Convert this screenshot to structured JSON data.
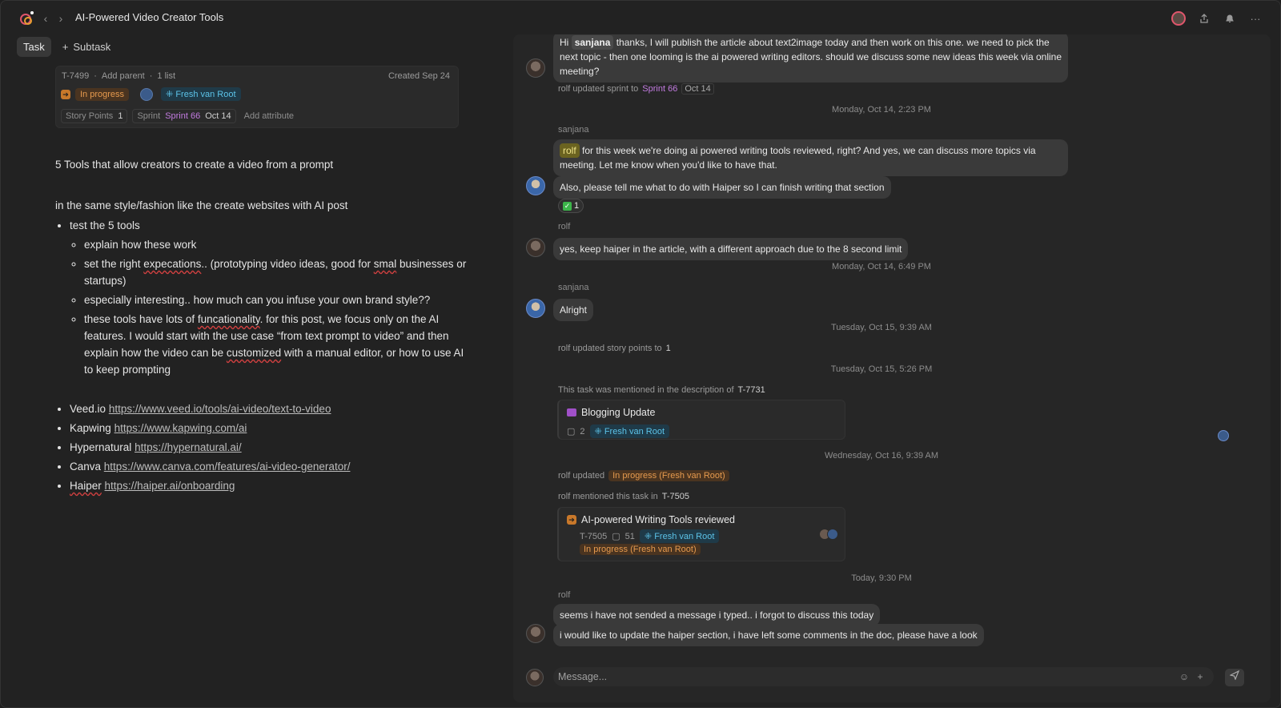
{
  "window": {
    "title": "AI-Powered Video Creator Tools"
  },
  "tabs": {
    "task": "Task",
    "subtask": "Subtask"
  },
  "meta": {
    "id": "T-7499",
    "add_parent": "Add parent",
    "lists": "1 list",
    "created": "Created Sep 24",
    "status": "In progress",
    "team": "Fresh van Root",
    "story_points_label": "Story Points",
    "story_points": "1",
    "sprint_label": "Sprint",
    "sprint": "Sprint 66",
    "sprint_date": "Oct 14",
    "add_attribute": "Add attribute"
  },
  "doc": {
    "heading": "5 Tools that allow creators to create a video from a prompt",
    "intro": "in the same style/fashion like the create websites with AI post",
    "bullet1": "test the 5 tools",
    "sub1": "explain how these work",
    "sub2a": "set the right ",
    "sub2b": "expecations",
    "sub2c": ".. (prototyping video ideas, good for ",
    "sub2d": "smal",
    "sub2e": " businesses or startups)",
    "sub3": "especially interesting.. how much can you infuse your own brand style??",
    "sub4a": "these tools have lots of ",
    "sub4b": "funcationality",
    "sub4c": ". for this post, we focus only on the AI features. I would start with the use case “from text prompt to video” and then explain how the video can be ",
    "sub4d": "customized",
    "sub4e": " with a manual editor, or how to use AI to keep prompting",
    "links": [
      {
        "name": "Veed.io",
        "url": "https://www.veed.io/tools/ai-video/text-to-video"
      },
      {
        "name": "Kapwing",
        "url": "https://www.kapwing.com/ai"
      },
      {
        "name": "Hypernatural",
        "url": "https://hypernatural.ai/"
      },
      {
        "name": "Canva",
        "url": "https://www.canva.com/features/ai-video-generator/"
      },
      {
        "name": "Haiper",
        "url": "https://haiper.ai/onboarding"
      }
    ]
  },
  "chat": {
    "m1_pre": "Hi",
    "m1_mention": "sanjana",
    "m1_post": " thanks, I will publish the article about text2image today and then work on this one. we need to pick the next topic - then one looming is the ai powered writing editors. should we discuss some new ideas this week via online meeting?",
    "sys1_pre": "rolf updated sprint to",
    "sys1_sprint": "Sprint 66",
    "sys1_date": "Oct 14",
    "date1": "Monday, Oct 14, 2:23 PM",
    "sender_sanjana": "sanjana",
    "sender_rolf": "rolf",
    "m2_mention": "rolf",
    "m2_text": " for this week we're doing ai powered writing tools reviewed, right? And yes, we can discuss more topics via meeting. Let me know when you'd like to have that.",
    "m3": "Also, please tell me what to do with Haiper so I can finish writing that section",
    "reaction_count": "1",
    "m4": "yes, keep haiper in the article, with a different approach due to the 8 second limit",
    "date2": "Monday, Oct 14, 6:49 PM",
    "m5": "Alright",
    "date3": "Tuesday, Oct 15, 9:39 AM",
    "sys2_pre": "rolf updated story points to",
    "sys2_val": "1",
    "date4": "Tuesday, Oct 15, 5:26 PM",
    "sys3_pre": "This task was mentioned in the description of",
    "sys3_id": "T-7731",
    "card1_title": "Blogging Update",
    "card1_comments": "2",
    "card1_team": "Fresh van Root",
    "date5": "Wednesday, Oct 16, 9:39 AM",
    "sys4_pre": "rolf updated",
    "sys4_status": "In progress (Fresh van Root)",
    "sys5_pre": "rolf mentioned this task in",
    "sys5_id": "T-7505",
    "card2_title": "AI-powered Writing Tools reviewed",
    "card2_id": "T-7505",
    "card2_comments": "51",
    "card2_team": "Fresh van Root",
    "card2_status": "In progress (Fresh van Root)",
    "date6": "Today, 9:30 PM",
    "m6": "seems i have not sended a message i typed.. i forgot to discuss this today",
    "m7": "i would like to update the haiper section, i have left some comments in the doc, please have a look",
    "composer_placeholder": "Message..."
  }
}
